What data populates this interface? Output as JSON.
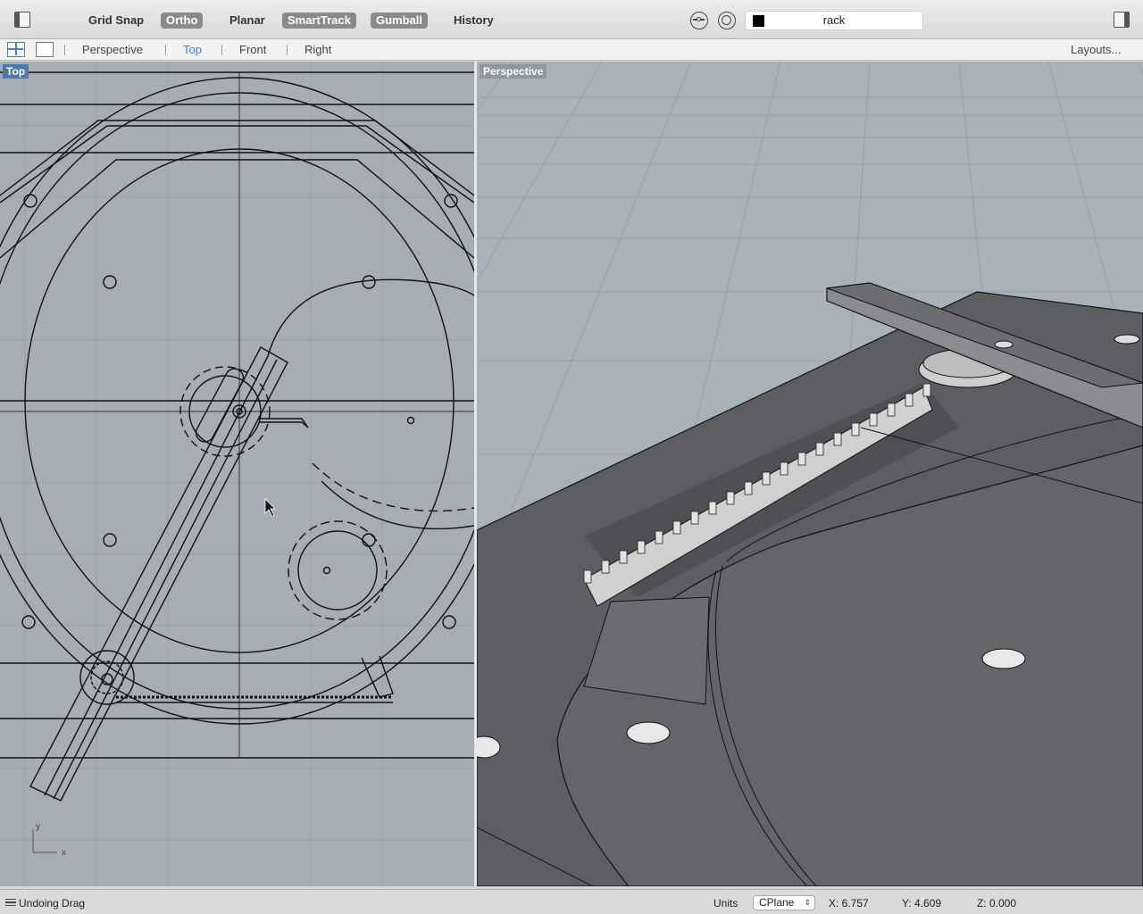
{
  "toolbar": {
    "left_panel_icon": "left-panel-toggle-icon",
    "right_panel_icon": "right-panel-toggle-icon",
    "grid_snap": "Grid Snap",
    "ortho": "Ortho",
    "planar": "Planar",
    "smarttrack": "SmartTrack",
    "gumball": "Gumball",
    "history": "History",
    "osnap_icon": "osnap-icon",
    "record_icon": "target-circle-icon",
    "layer": {
      "swatch_color": "#000000",
      "name": "rack"
    }
  },
  "viewtabs": {
    "layout_icons": [
      "four-viewport-icon",
      "single-viewport-icon"
    ],
    "tabs": [
      "Perspective",
      "Top",
      "Front",
      "Right"
    ],
    "active": "Top",
    "layouts": "Layouts..."
  },
  "viewports": {
    "top": {
      "label": "Top",
      "axis_x": "x",
      "axis_y": "y",
      "background": "#a6adb4"
    },
    "perspective": {
      "label": "Perspective",
      "background": "#a9b1b9"
    }
  },
  "status": {
    "menu_icon": "status-menu-icon",
    "message": "Undoing Drag",
    "units": "Units",
    "cplane": "CPlane",
    "x": "X: 6.757",
    "y": "Y: 4.609",
    "z": "Z: 0.000"
  },
  "colors": {
    "accent": "#3c7de6",
    "toggle_on": "#8a8a8a",
    "viewport_label": "#4f79a8"
  }
}
